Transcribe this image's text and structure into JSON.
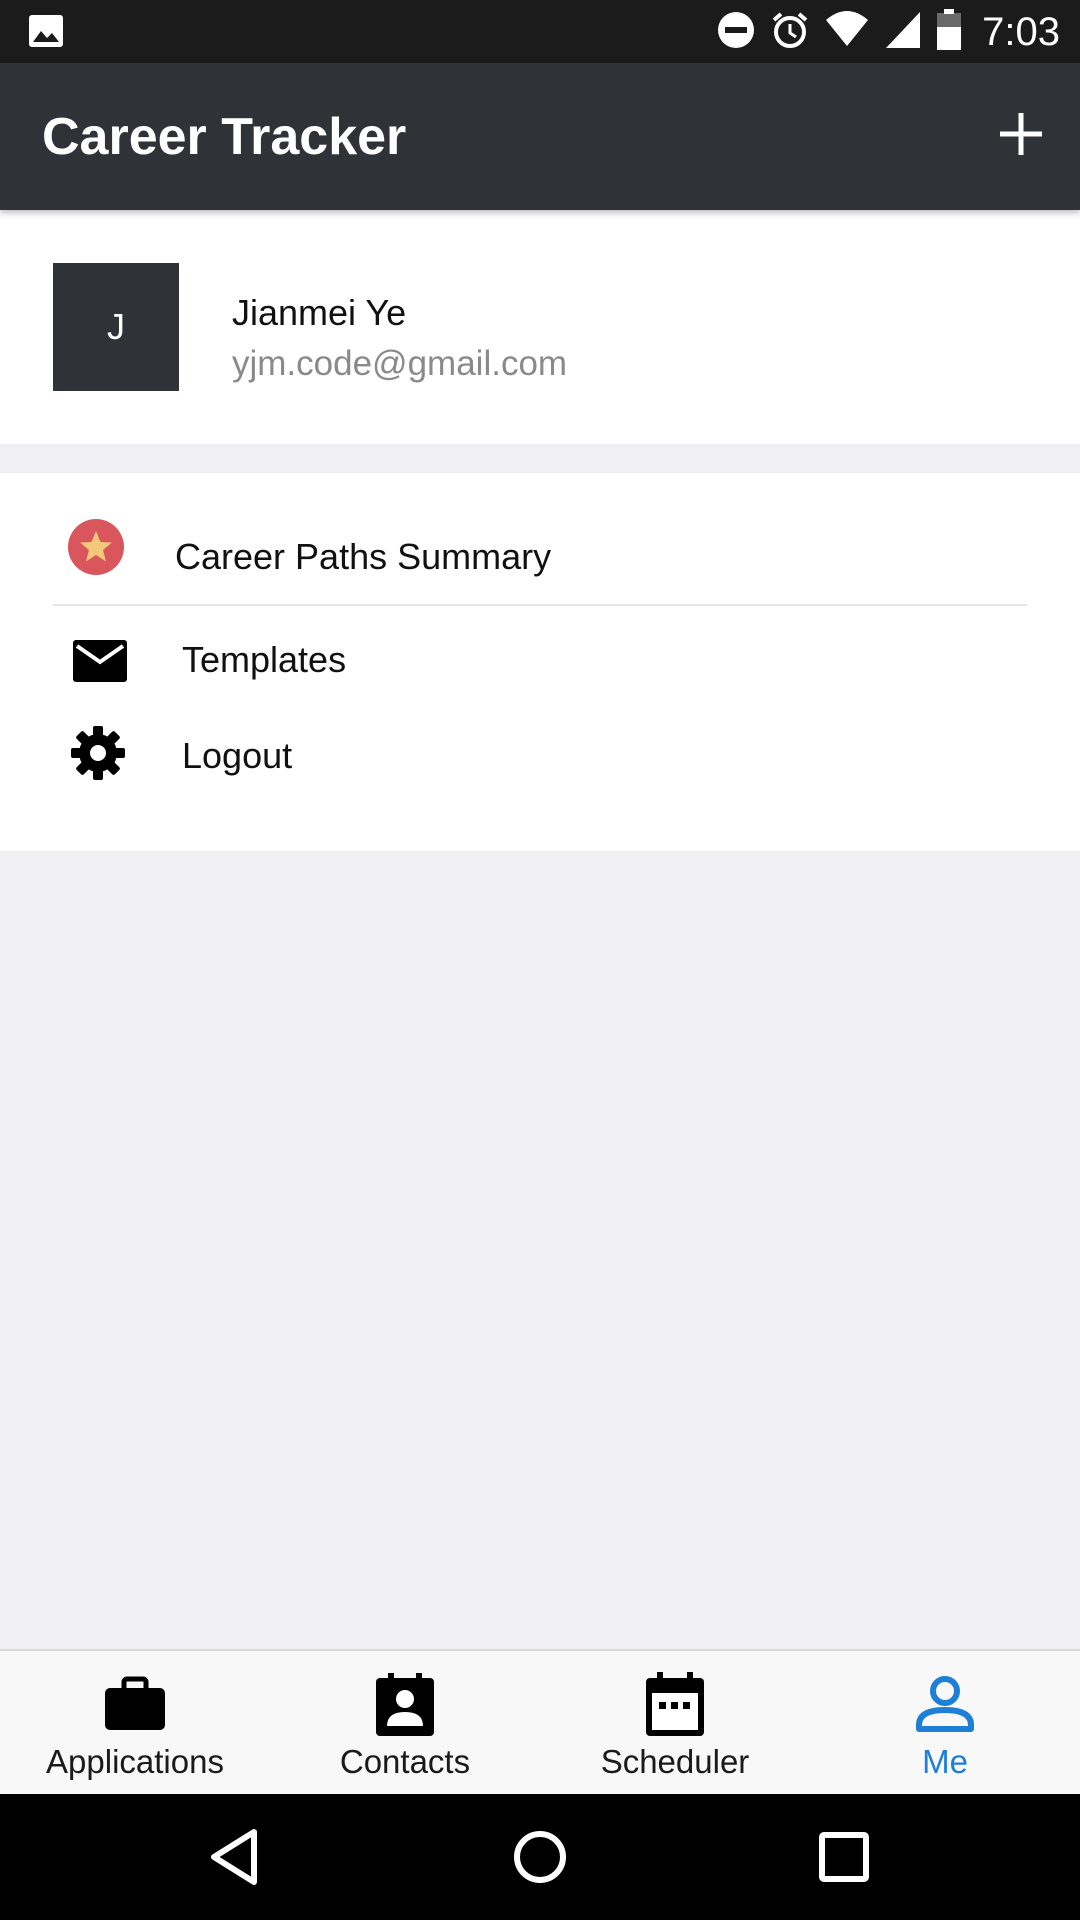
{
  "status_bar": {
    "time": "7:03",
    "icons": [
      "image-icon",
      "dnd-icon",
      "alarm-icon",
      "wifi-icon",
      "signal-icon",
      "battery-icon"
    ]
  },
  "app_bar": {
    "title": "Career Tracker",
    "add_icon": "plus-icon"
  },
  "profile": {
    "avatar_letter": "J",
    "name": "Jianmei Ye",
    "email": "yjm.code@gmail.com"
  },
  "menu": {
    "items": [
      {
        "label": "Career Paths Summary",
        "icon": "star-badge-icon"
      },
      {
        "label": "Templates",
        "icon": "mail-icon"
      },
      {
        "label": "Logout",
        "icon": "gear-icon"
      }
    ]
  },
  "bottom_nav": {
    "tabs": [
      {
        "label": "Applications",
        "icon": "briefcase-icon"
      },
      {
        "label": "Contacts",
        "icon": "contact-card-icon"
      },
      {
        "label": "Scheduler",
        "icon": "calendar-icon"
      },
      {
        "label": "Me",
        "icon": "person-icon",
        "active": true
      }
    ],
    "active_color": "#1e7fd6"
  },
  "colors": {
    "app_bar": "#2f3337",
    "background": "#efeff4",
    "star_badge": "#d9575c",
    "star": "#f3c87a"
  }
}
